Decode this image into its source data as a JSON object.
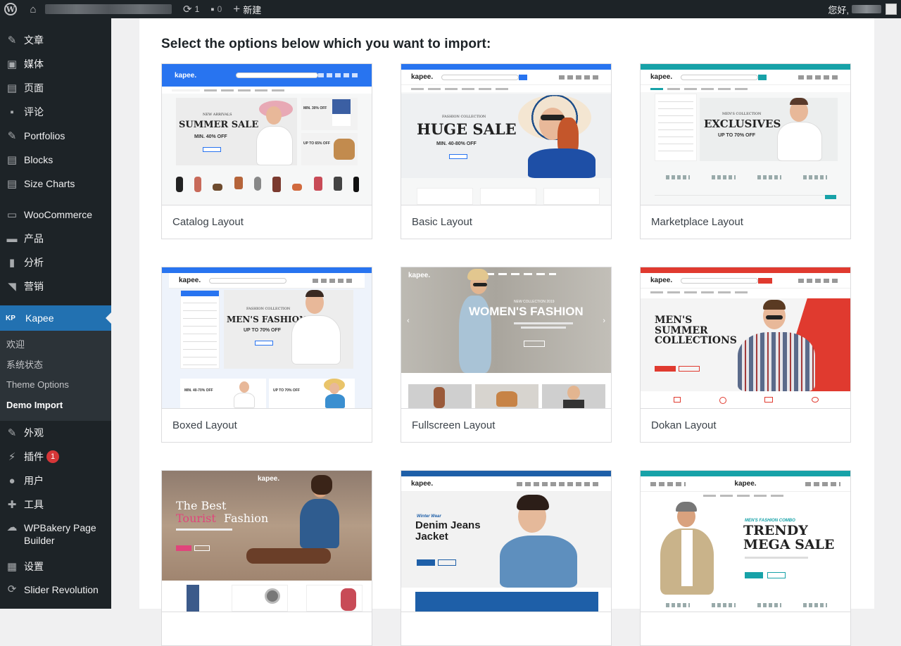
{
  "admin_bar": {
    "updates_count": "1",
    "comments_count": "0",
    "new_label": "新建",
    "greeting": "您好,"
  },
  "sidebar": {
    "items_top": [
      {
        "label": "文章",
        "icon": "pin-icon"
      },
      {
        "label": "媒体",
        "icon": "media-icon"
      },
      {
        "label": "页面",
        "icon": "page-icon"
      },
      {
        "label": "评论",
        "icon": "comment-icon"
      },
      {
        "label": "Portfolios",
        "icon": "pin-icon"
      },
      {
        "label": "Blocks",
        "icon": "document-icon"
      },
      {
        "label": "Size Charts",
        "icon": "document-icon"
      }
    ],
    "items_mid": [
      {
        "label": "WooCommerce",
        "icon": "woo-icon"
      },
      {
        "label": "产品",
        "icon": "archive-icon"
      },
      {
        "label": "分析",
        "icon": "bar-chart-icon"
      },
      {
        "label": "营销",
        "icon": "megaphone-icon"
      }
    ],
    "kapee": {
      "logo": "KP",
      "label": "Kapee"
    },
    "kapee_sub": [
      "欢迎",
      "系统状态",
      "Theme Options",
      "Demo Import"
    ],
    "items_bottom": [
      {
        "label": "外观",
        "icon": "brush-icon"
      },
      {
        "label": "插件",
        "icon": "plugin-icon",
        "badge": "1"
      },
      {
        "label": "用户",
        "icon": "user-icon"
      },
      {
        "label": "工具",
        "icon": "wrench-icon"
      },
      {
        "label": "WPBakery Page Builder",
        "icon": "cloud-icon"
      },
      {
        "label": "设置",
        "icon": "settings-icon"
      },
      {
        "label": "Slider Revolution",
        "icon": "refresh-icon"
      }
    ]
  },
  "main": {
    "title": "Select the options below which you want to import:",
    "layouts": [
      {
        "label": "Catalog Layout",
        "logo": "kapee.",
        "hero": "SUMMER SALE",
        "hero_sub": "MIN. 40% OFF",
        "hero_top": "NEW ARRIVALS",
        "accent": "#2874f0"
      },
      {
        "label": "Basic Layout",
        "logo": "kapee.",
        "hero": "HUGE SALE",
        "hero_sub": "MIN. 40-80% OFF",
        "hero_top": "FASHION COLLECTION",
        "accent": "#2874f0"
      },
      {
        "label": "Marketplace Layout",
        "logo": "kapee.",
        "hero": "EXCLUSIVES",
        "hero_sub": "UP TO 70% OFF",
        "hero_top": "MEN'S COLLECTION",
        "accent": "#17a2a8"
      },
      {
        "label": "Boxed Layout",
        "logo": "kapee.",
        "hero": "MEN'S FASHION",
        "hero_sub": "UP TO 70% OFF",
        "hero_top": "FASHION COLLECTION",
        "accent": "#2874f0"
      },
      {
        "label": "Fullscreen Layout",
        "logo": "kapee.",
        "hero": "WOMEN'S FASHION",
        "hero_sub": "",
        "hero_top": "NEW COLLECTION 2019",
        "accent": "#2874f0"
      },
      {
        "label": "Dokan Layout",
        "logo": "kapee.",
        "hero": "MEN'S SUMMER COLLECTIONS",
        "hero_sub": "",
        "hero_top": "",
        "accent": "#e03a2f"
      },
      {
        "label": "",
        "logo": "kapee.",
        "hero": "The Best",
        "hero_mid": "Tourist",
        "hero_end": "Fashion",
        "accent": "#e0457b"
      },
      {
        "label": "",
        "logo": "kapee.",
        "hero": "Denim Jeans Jacket",
        "hero_top": "Winter Wear",
        "accent": "#1e5fa8"
      },
      {
        "label": "",
        "logo": "kapee.",
        "hero": "TRENDY MEGA SALE",
        "hero_top": "MEN'S FASHION COMBO",
        "accent": "#17a2a8"
      }
    ]
  },
  "colors": {
    "admin_bg": "#1d2327",
    "active_menu": "#2271b1",
    "badge": "#d63638"
  }
}
